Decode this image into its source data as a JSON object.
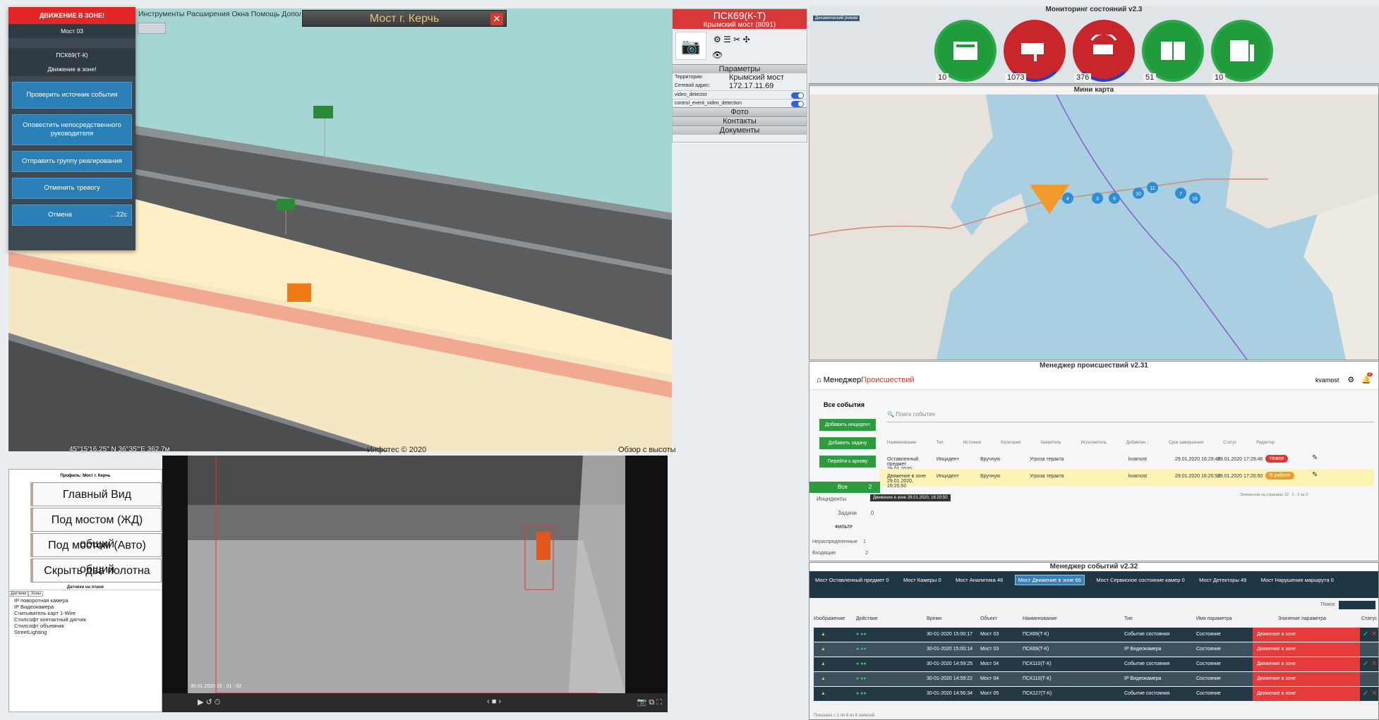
{
  "alarm": {
    "title": "ДВИЖЕНИЕ В ЗОНЕ!",
    "object": "Мост 03",
    "device": "ПСК69(Т-К)",
    "message": "Движение в зоне!",
    "btn_check": "Проверить источник события",
    "btn_notify": "Оповестить непосредственного руководителя",
    "btn_send": "Отправить группу реагирования",
    "btn_cancel_alarm": "Отменить тревогу",
    "btn_cancel": "Отмена",
    "timer": "...22с"
  },
  "menubar": "Инструменты Расширения Окна Помощь Дополнит",
  "scene": {
    "title": "Мост г. Керчь",
    "foot_left": "45°15'16.25\" N 36°35'\"E 362,7м",
    "foot_mid": "Инфотес © 2020",
    "foot_right": "Обзор с высоты"
  },
  "device_panel": {
    "title": "ПСК69(К-Т)",
    "subtitle": "Крымский мост (8091)",
    "params": "Параметры",
    "territory_label": "Территория:",
    "territory": "Крымский мост",
    "ip_label": "Сетевой адрес:",
    "ip": "172.17.11.69",
    "opt1": "video_detector",
    "opt2": "control_event_video_detection",
    "photo": "Фото",
    "contacts": "Контакты",
    "docs": "Документы"
  },
  "monitor": {
    "title": "Мониторинг состояний v2.3",
    "tag": "Динамический режим",
    "counts": [
      "10",
      "1073",
      "376",
      "51",
      "10"
    ],
    "colors": [
      "#1f9b3c",
      "#c8262a",
      "#c8262a",
      "#1f9b3c",
      "#1f9b3c"
    ]
  },
  "minimap": {
    "title": "Мини карта",
    "markers": [
      "4",
      "3",
      "9",
      "10",
      "11",
      "7",
      "16"
    ]
  },
  "incidents": {
    "title": "Менеджер происшествий v2.31",
    "brand1": "Менеджер ",
    "brand2": "Происшествий",
    "user": "kvamost",
    "notif": "2",
    "all_events": "Все события",
    "btn_add_inc": "Добавить инцидент",
    "btn_add_task": "Добавить задачу",
    "btn_archive": "Перейти к архиву",
    "search": "Поиск события",
    "cols": [
      "Наименование",
      "Тип",
      "Источник",
      "Категория",
      "Заявитель",
      "Исполнитель",
      "Добавлен ↓",
      "Срок завершения",
      "Статус",
      "Редактор"
    ],
    "rows": [
      {
        "name": "Оставленный предмет 29.01.2020, 16:29:46",
        "type": "Инцидент",
        "src": "Вручную",
        "cat": "Угроза теракта",
        "exec": "kvamost",
        "added": "29.01.2020 16:29:46",
        "due": "29.01.2020 17:29:46",
        "status": "Новое"
      },
      {
        "name": "Движение в зоне 29.01.2020, 16:20:50",
        "type": "Инцидент",
        "src": "Вручную",
        "cat": "Угроза теракта",
        "exec": "kvamost",
        "added": "29.01.2020 16:20:50",
        "due": "29.01.2020 17:20:50",
        "status": "В работе"
      }
    ],
    "side": [
      "Все",
      "Инциденты",
      "Задачи"
    ],
    "side_counts": [
      "2",
      "2",
      "0"
    ],
    "filter": "ФИЛЬТР",
    "unassigned": "Нераспределенные",
    "unassigned_n": "1",
    "incoming": "Входящие",
    "incoming_n": "2",
    "tooltip": "Движение в зоне 29.01.2020, 16:20:50",
    "pager": "Элементов на странице",
    "pager_n": "10",
    "pager_range": "1 - 2 из 2"
  },
  "events": {
    "title": "Менеджер событий v2.32",
    "tabs": [
      "Мост Оставленный предмет 0",
      "Мост Камеры 0",
      "Мост Аналитика 46",
      "Мост Движение в зоне 66",
      "Мост Сервисное состояние камер 0",
      "Мост Детекторы 49",
      "Мост Нарушение маршрута 0"
    ],
    "search": "Поиск:",
    "cols": [
      "Изображение",
      "Действие",
      "Время",
      "Объект",
      "Наименование",
      "Тип",
      "Имя параметра",
      "Значение параметра",
      "Статус"
    ],
    "rows": [
      {
        "time": "30-01-2020 15:00:17",
        "obj": "Мост 03",
        "name": "ПСК69(Т-К)",
        "type": "Событие состояния",
        "param": "Состояние",
        "value": "Движение в зоне"
      },
      {
        "time": "30-01-2020 15:00:14",
        "obj": "Мост 03",
        "name": "ПСК69(Т-К)",
        "type": "IP Видеокамера",
        "param": "Состояние",
        "value": "Движение в зоне"
      },
      {
        "time": "30-01-2020 14:59:25",
        "obj": "Мост 04",
        "name": "ПСК110(Т-К)",
        "type": "Событие состояния",
        "param": "Состояние",
        "value": "Движение в зоне"
      },
      {
        "time": "30-01-2020 14:59:22",
        "obj": "Мост 04",
        "name": "ПСК110(Т-К)",
        "type": "IP Видеокамера",
        "param": "Состояние",
        "value": "Движение в зоне"
      },
      {
        "time": "30-01-2020 14:56:34",
        "obj": "Мост 05",
        "name": "ПСК127(Т-К)",
        "type": "Событие состояния",
        "param": "Состояние",
        "value": "Движение в зоне"
      }
    ],
    "footer": "Показано с 1 по 6 из 6 записей"
  },
  "views": {
    "title": "Профиль: Мост г. Керчь",
    "items": [
      "Главный Вид",
      "Под мостом (ЖД) общий",
      "Под мостом (Авто) общий",
      "Скрыть два полотна"
    ],
    "sensors_title": "Датчики на плане",
    "tabs": [
      "Датчики",
      "Зоны"
    ],
    "sensors": [
      "IP поворотная камера",
      "IP Видеокамера",
      "Считыватель карт 1-Wire",
      "Стилсофт контактный датчик",
      "Стилсофт объемник",
      "StreetLighting"
    ]
  },
  "video": {
    "timestamp": "30.01.2020 15 : 01 : 02"
  }
}
